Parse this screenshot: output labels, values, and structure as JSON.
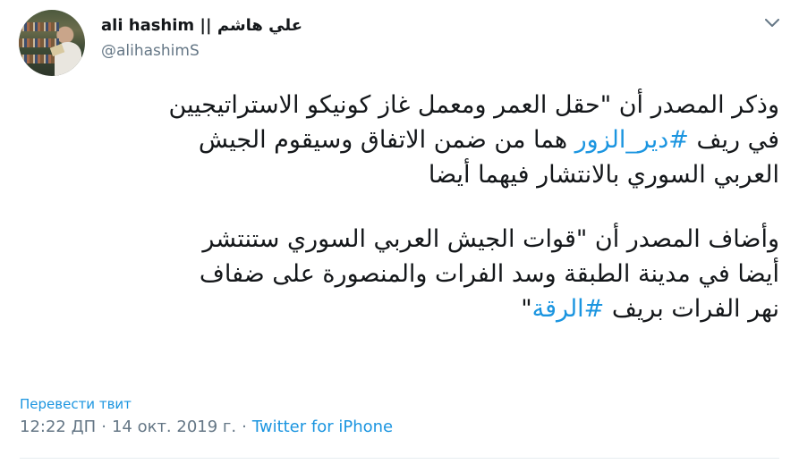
{
  "user": {
    "display_name": "ali hashim || علي هاشم",
    "handle": "@alihashimS"
  },
  "tweet": {
    "para1": {
      "line1": "وذكر المصدر أن \"حقل العمر ومعمل غاز كونيكو الاستراتيجيين",
      "line2_before": "في ريف ",
      "line2_hashtag": "#دير_الزور",
      "line2_after": " هما من ضمن الاتفاق وسيقوم الجيش",
      "line3": "العربي السوري بالانتشار فيهما أيضا"
    },
    "para2": {
      "line1": "وأضاف المصدر أن \"قوات الجيش العربي السوري ستنتشر",
      "line2": "أيضا في مدينة الطبقة وسد الفرات والمنصورة على ضفاف",
      "line3_before": "نهر الفرات بريف ",
      "line3_hashtag": "#الرقة",
      "line3_after": "\""
    }
  },
  "translate_label": "Перевести твит",
  "meta": {
    "time": "12:22 ДП",
    "separator": "·",
    "date": "14 окт. 2019 г.",
    "source": "Twitter for iPhone"
  },
  "icons": {
    "caret": "chevron-down-icon"
  },
  "colors": {
    "link": "#1b95e0",
    "secondary_text": "#657786",
    "primary_text": "#14171a"
  }
}
